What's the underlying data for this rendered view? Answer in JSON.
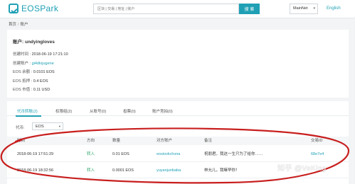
{
  "header": {
    "logo_text": "EOSPark",
    "search_placeholder": "区块 | 交易 | 地址 | 账户",
    "search_button": "搜 索",
    "network": "MainNet",
    "language": "English"
  },
  "breadcrumb": [
    "首页",
    "账户"
  ],
  "account": {
    "title_label": "账户:",
    "title_value": "undyingloves",
    "rows": [
      {
        "label": "创建时间 :",
        "value": "2018-06-19 17:21:10"
      },
      {
        "label": "创建账户 :",
        "value": "gi4dlojugene"
      },
      {
        "label": "EOS 余额 :",
        "value": "0.0101 EOS"
      },
      {
        "label": "EOS 抵押 :",
        "value": "0.4 EOS"
      },
      {
        "label": "EOS 市值 :",
        "value": "0.11 USD"
      }
    ]
  },
  "tabs": [
    "代币转账(2)",
    "权限组(2)",
    "从账号(0)",
    "投票(0)",
    "账户竞拍(0)"
  ],
  "token_filter": {
    "label": "代币:",
    "value": "EOS"
  },
  "table": {
    "headers": [
      "时间",
      "方向",
      "数量",
      "对方账户",
      "备注",
      "交易ID"
    ],
    "rows": [
      {
        "time": "2018-06-19 17:51:29",
        "dir": "转入",
        "amount": "0.01 EOS",
        "peer": "eosiovkchvna",
        "memo": "祝朋君，我这一生只为了给你……",
        "txid": "68e7e4"
      },
      {
        "time": "2018-06-19 18:32:56",
        "dir": "转入",
        "amount": "0.0001 EOS",
        "peer": "yuyanjunbaba",
        "memo": "林允儿，我嘛早你！",
        "txid": ""
      }
    ]
  },
  "watermark": "知乎 @VeKing",
  "colors": {
    "accent": "#1fa0b5",
    "annotation": "#c81e1e",
    "incoming": "#2aa36b"
  }
}
